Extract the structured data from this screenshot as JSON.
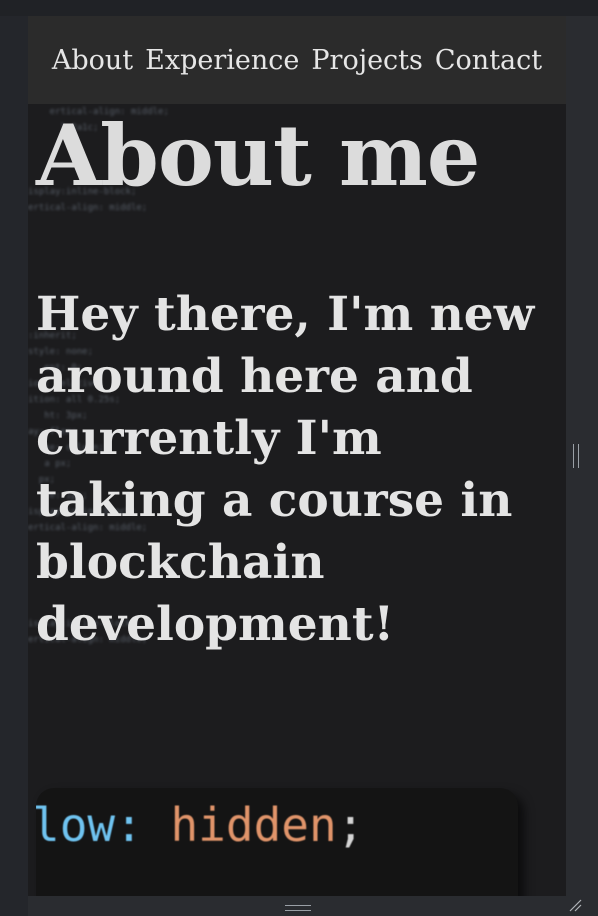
{
  "nav": {
    "items": [
      {
        "label": "About"
      },
      {
        "label": "Experience"
      },
      {
        "label": "Projects"
      },
      {
        "label": "Contact"
      }
    ]
  },
  "about": {
    "title": "About me",
    "bio": "Hey there, I'm new around here and currently I'm taking a course in blockchain development!"
  },
  "code_card": {
    "property": "low:",
    "value": "hidden",
    "end": ";",
    "second_line": "   ·    ·"
  },
  "background_code": [
    "    ertical-align: middle;",
    "      l-2a1c;",
    "",
    "",
    "",
    "isplay:inline-block;",
    "ertical-align: middle;",
    "",
    "",
    "",
    "",
    "",
    "",
    "",
    ":inherit;",
    "style: none;",
    "   ent: 0;",
    "ion: relative;",
    "ition: all 0.25s;",
    "   ht: 3px;",
    "ay: flex;",
    "   ke: column;",
    "   a px;",
    "  px;",
    "   ce: 1px;",
    "isplay:inline-block;",
    "ertical-align: middle;",
    "",
    "",
    "",
    "",
    "",
    "isplay:inline-block;",
    "ertical-align: middle;"
  ],
  "colors": {
    "page_bg": "#1c1c1e",
    "nav_bg": "#2b2b2b",
    "text": "#e4e4e4",
    "code_keyword": "#6fc3f0",
    "code_value": "#e0946a"
  }
}
